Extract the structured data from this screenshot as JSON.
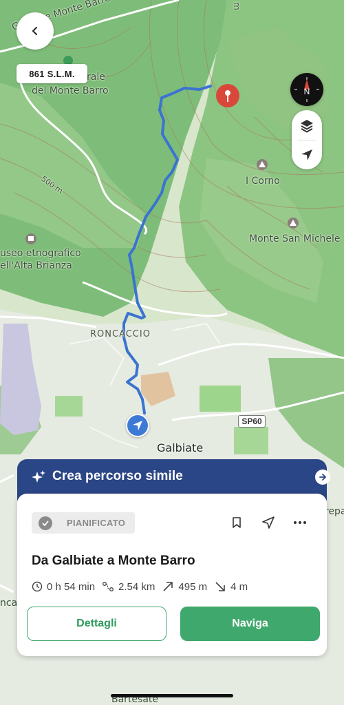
{
  "map": {
    "labels": {
      "top_road": "Galbiate Monte Barro",
      "peak_name_1": "rale",
      "peak_name_2": "del Monte Barro",
      "contour_500": "500 m",
      "museum_1": "useo etnografico",
      "museum_2": "ell'Alta Brianza",
      "i_corno": "I Corno",
      "monte_san_michele": "Monte San Michele",
      "roncaccio": "RONCACCIO",
      "galbiate": "Galbiate",
      "sp60": "SP60",
      "rep": "repa",
      "nca": "nca",
      "bartesate": "Bartesate",
      "top_dm": "m"
    },
    "altitude_badge": "861 S.L.M.",
    "route_color": "#3b73d0",
    "pin_color": "#d9473a"
  },
  "banner": {
    "label": "Crea percorso simile",
    "color": "#2b4686"
  },
  "card": {
    "status": "PIANIFICATO",
    "title": "Da Galbiate a Monte Barro",
    "stats": {
      "duration": "0 h 54 min",
      "distance": "2.54 km",
      "ascent": "495 m",
      "descent": "4 m"
    },
    "details_label": "Dettagli",
    "navigate_label": "Naviga",
    "accent": "#3fa86c"
  }
}
